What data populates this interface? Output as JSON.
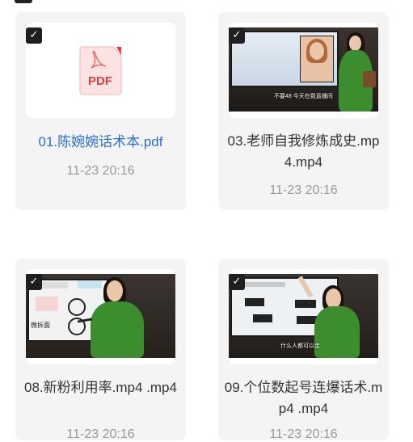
{
  "files": [
    {
      "name": "01.陈婉婉话术本.pdf",
      "date": "11-23 20:16",
      "type": "pdf",
      "icon": "pdf-file-icon",
      "icon_label": "PDF",
      "selected": true
    },
    {
      "name": "03.老师自我修炼成史.mp4.mp4",
      "date": "11-23 20:16",
      "type": "video",
      "subtitle": "不要48 今天在我直播间",
      "selected": true
    },
    {
      "name": "08.新粉利用率.mp4 .mp4",
      "date": "11-23 20:16",
      "type": "video",
      "screen_text": "微拆面",
      "selected": true
    },
    {
      "name": "09.个位数起号连爆话术.mp4 .mp4",
      "date": "11-23 20:16",
      "type": "video",
      "subtitle": "什么人都可以走",
      "selected": true
    }
  ],
  "colors": {
    "card_bg": "#f4f4f4",
    "pdf_link": "#2a6dd1",
    "date": "#999999",
    "pdf_red": "#e03c3c",
    "coat_green": "#3b8d2d"
  }
}
